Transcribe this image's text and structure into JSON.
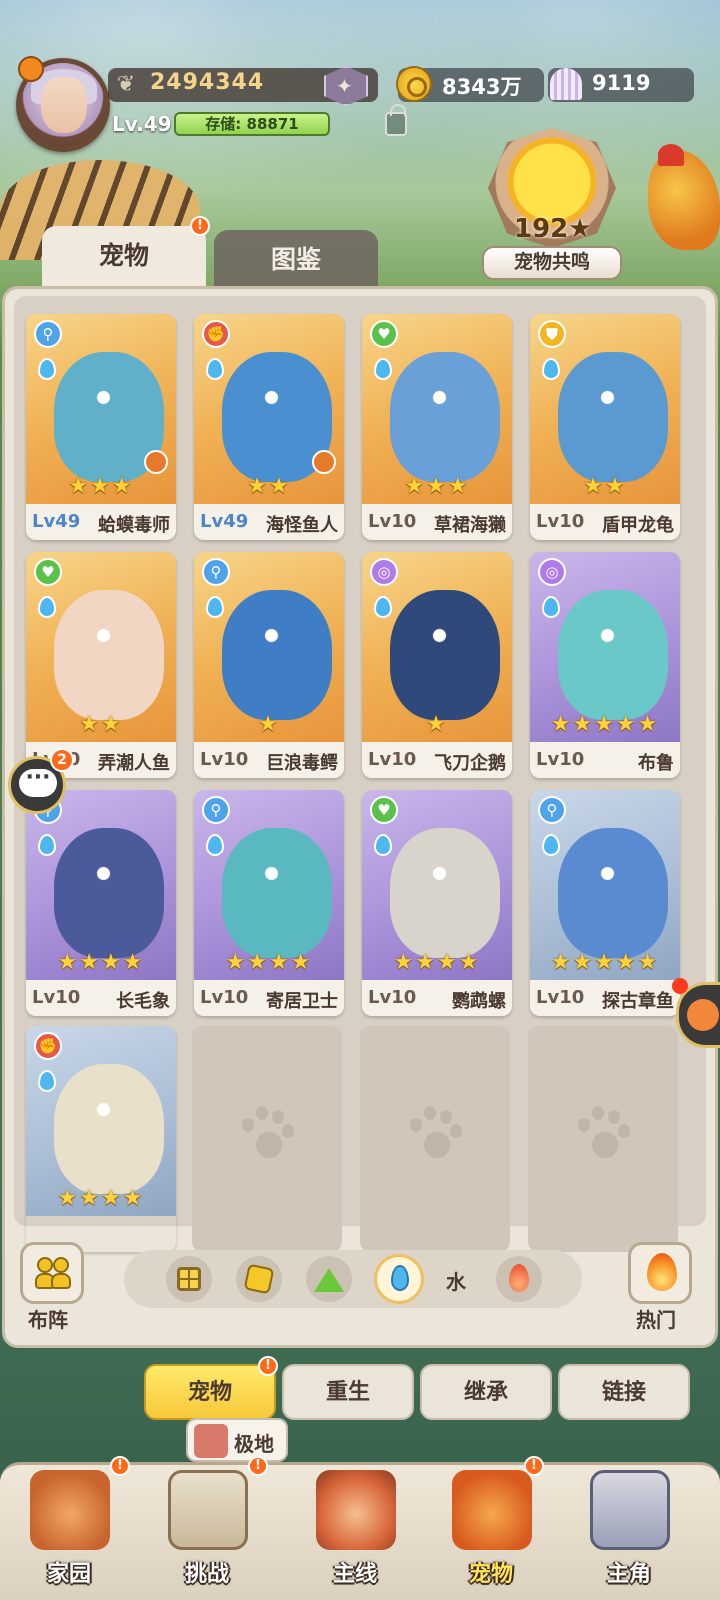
{
  "player": {
    "power": "2494344",
    "level": "Lv.49",
    "storage_label": "存储: 88871"
  },
  "resources": {
    "coins": "8343万",
    "shells": "9119"
  },
  "resonance": {
    "count": "192★",
    "label": "宠物共鸣"
  },
  "tabs": [
    {
      "label": "宠物",
      "badge": "!"
    },
    {
      "label": "图鉴"
    }
  ],
  "pets": [
    {
      "level": "Lv49",
      "name": "蛤蟆毒师",
      "stars": "★★★",
      "type": "blue",
      "type_glyph": "⚲",
      "frame": "gold",
      "color": "#5fb0c8"
    },
    {
      "level": "Lv49",
      "name": "海怪鱼人",
      "stars": "★★",
      "type": "red",
      "type_glyph": "✊",
      "frame": "gold",
      "color": "#4a8fd0"
    },
    {
      "level": "Lv10",
      "name": "草裙海獭",
      "stars": "★★★",
      "type": "green",
      "type_glyph": "♥",
      "frame": "gold",
      "color": "#6aa0d8"
    },
    {
      "level": "Lv10",
      "name": "盾甲龙龟",
      "stars": "★★",
      "type": "yellow",
      "type_glyph": "⛊",
      "frame": "gold",
      "color": "#5a9ad0"
    },
    {
      "level": "Lv10",
      "name": "弄潮人鱼",
      "stars": "★★",
      "type": "green",
      "type_glyph": "♥",
      "frame": "gold",
      "color": "#f2d6c4"
    },
    {
      "level": "Lv10",
      "name": "巨浪毒鳄",
      "stars": "★",
      "type": "blue",
      "type_glyph": "⚲",
      "frame": "gold",
      "color": "#3f7ec4"
    },
    {
      "level": "Lv10",
      "name": "飞刀企鹅",
      "stars": "★",
      "type": "purple",
      "type_glyph": "◎",
      "frame": "gold",
      "color": "#2f4a7a"
    },
    {
      "level": "Lv10",
      "name": "布鲁",
      "stars": "★★★★★",
      "type": "purple",
      "type_glyph": "◎",
      "frame": "purple",
      "color": "#6ac8c8"
    },
    {
      "level": "Lv10",
      "name": "长毛象",
      "stars": "★★★★",
      "type": "blue",
      "type_glyph": "⚲",
      "frame": "purple",
      "color": "#4a5a9a"
    },
    {
      "level": "Lv10",
      "name": "寄居卫士",
      "stars": "★★★★",
      "type": "blue",
      "type_glyph": "⚲",
      "frame": "purple",
      "color": "#5ab8c0"
    },
    {
      "level": "Lv10",
      "name": "鹦鹉螺",
      "stars": "★★★★",
      "type": "green",
      "type_glyph": "♥",
      "frame": "purple",
      "color": "#d8d4cc"
    },
    {
      "level": "Lv10",
      "name": "探古章鱼",
      "stars": "★★★★★",
      "type": "blue",
      "type_glyph": "⚲",
      "frame": "blue",
      "color": "#5a8ad0"
    },
    {
      "level": "",
      "name": "",
      "stars": "★★★★",
      "type": "red",
      "type_glyph": "✊",
      "frame": "blue",
      "color": "#e8e0c8"
    }
  ],
  "filter": {
    "formation_label": "布阵",
    "element_label": "水",
    "hot_label": "热门"
  },
  "actions": [
    {
      "label": "宠物",
      "badge": "!"
    },
    {
      "label": "重生"
    },
    {
      "label": "继承"
    },
    {
      "label": "链接"
    }
  ],
  "tooltip": {
    "label": "极地"
  },
  "nav": [
    {
      "label": "家园",
      "badge": "!"
    },
    {
      "label": "挑战",
      "badge": "!"
    },
    {
      "label": "主线"
    },
    {
      "label": "宠物",
      "badge": "!"
    },
    {
      "label": "主角"
    }
  ],
  "chat": {
    "badge": "2"
  },
  "colors": {
    "accent_gold": "#f7c83a",
    "badge_orange": "#ff6a1a",
    "level_blue": "#4a86c8"
  }
}
